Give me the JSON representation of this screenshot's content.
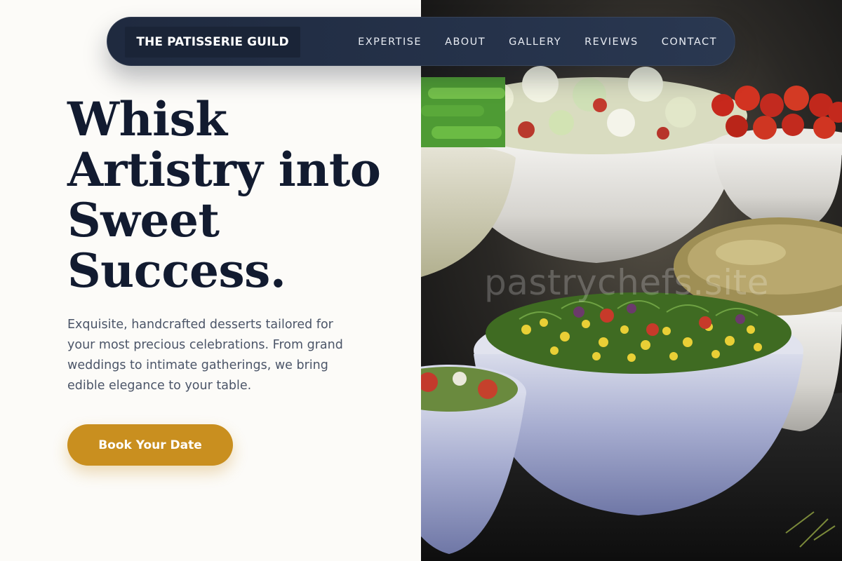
{
  "nav": {
    "brand": "THE PATISSERIE GUILD",
    "links": [
      "EXPERTISE",
      "ABOUT",
      "GALLERY",
      "REVIEWS",
      "CONTACT"
    ]
  },
  "hero": {
    "headline_lines": [
      "Whisk",
      "Artistry into",
      "Sweet",
      "Success."
    ],
    "lede": "Exquisite, handcrafted desserts tailored for your most precious celebrations. From grand weddings to intimate gatherings, we bring edible elegance to your table.",
    "cta_label": "Book Your Date"
  },
  "image": {
    "description_icon": "salad-bowls-photo",
    "watermark": "pastrychefs.site"
  },
  "colors": {
    "navy": "#121b30",
    "nav_bg": "#1f2a3f",
    "accent_gold": "#c98f1f",
    "body_text": "#4b5568",
    "page_bg": "#fcfbf8"
  }
}
